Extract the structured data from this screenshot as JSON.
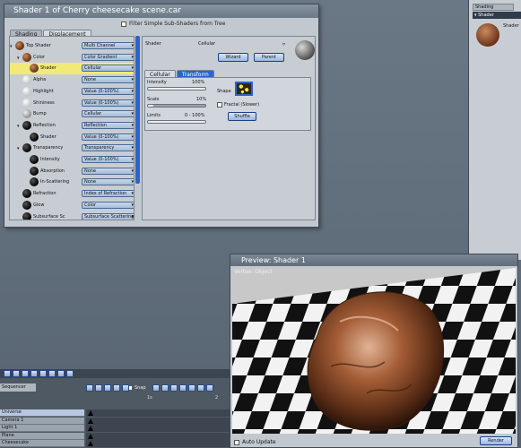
{
  "shader_window": {
    "title": "Shader 1 of Cherry cheesecake scene.car",
    "filter_label": "Filter Simple Sub-Shaders from Tree",
    "tabs": [
      "Shading",
      "Displacement"
    ],
    "tree": [
      {
        "label": "Top Shader",
        "value": "Multi Channel"
      },
      {
        "label": "Color",
        "value": "Color Gradient"
      },
      {
        "label": "Shader",
        "value": "Cellular"
      },
      {
        "label": "Alpha",
        "value": "None"
      },
      {
        "label": "Highlight",
        "value": "Value (0-100%)"
      },
      {
        "label": "Shininess",
        "value": "Value (0-100%)"
      },
      {
        "label": "Bump",
        "value": "Cellular"
      },
      {
        "label": "Reflection",
        "value": "Reflection"
      },
      {
        "label": "Shader",
        "value": "Value (0-100%)"
      },
      {
        "label": "Transparency",
        "value": "Transparency"
      },
      {
        "label": "Intensity",
        "value": "Value (0-100%)"
      },
      {
        "label": "Absorption",
        "value": "None"
      },
      {
        "label": "In-Scattering",
        "value": "None"
      },
      {
        "label": "Refraction",
        "value": "Index of Refraction"
      },
      {
        "label": "Glow",
        "value": "Color"
      },
      {
        "label": "Subsurface Sc",
        "value": "Subsurface Scattering"
      }
    ],
    "detail": {
      "shader_label": "Shader",
      "shader_value": "Cellular",
      "wizard_label": "Wizard",
      "parent_label": "Parent",
      "inner_tabs": [
        "Cellular",
        "Transform"
      ],
      "intensity_label": "Intensity",
      "intensity_value": "100%",
      "intensity_fraction": 1.0,
      "scale_label": "Scale",
      "scale_value": "10%",
      "scale_fraction": 0.1,
      "limits_label": "Limits",
      "limits_value": "0 - 100%",
      "shape_label": "Shape",
      "fractal_label": "Fractal (Slower)",
      "shuffle_label": "Shuffle"
    }
  },
  "right_palette": {
    "tab": "Shading",
    "section": "Shader",
    "item_label": "Shader"
  },
  "preview": {
    "title": "Preview: Shader 1",
    "canvas_caption": "Vertex: Object",
    "auto_update_label": "Auto Update",
    "render_label": "Render"
  },
  "timeline": {
    "mode": "Sequencer",
    "snap_label": "Snap",
    "tracks": [
      "Universe",
      "Camera 1",
      "Light 1",
      "Plane",
      "Cheesecake"
    ],
    "ruler_marks": [
      "1s",
      "2"
    ]
  },
  "colors": {
    "selected_row": "#f1ea78",
    "accent_blue": "#2c64c9",
    "window_bg": "#c2c8cf"
  }
}
